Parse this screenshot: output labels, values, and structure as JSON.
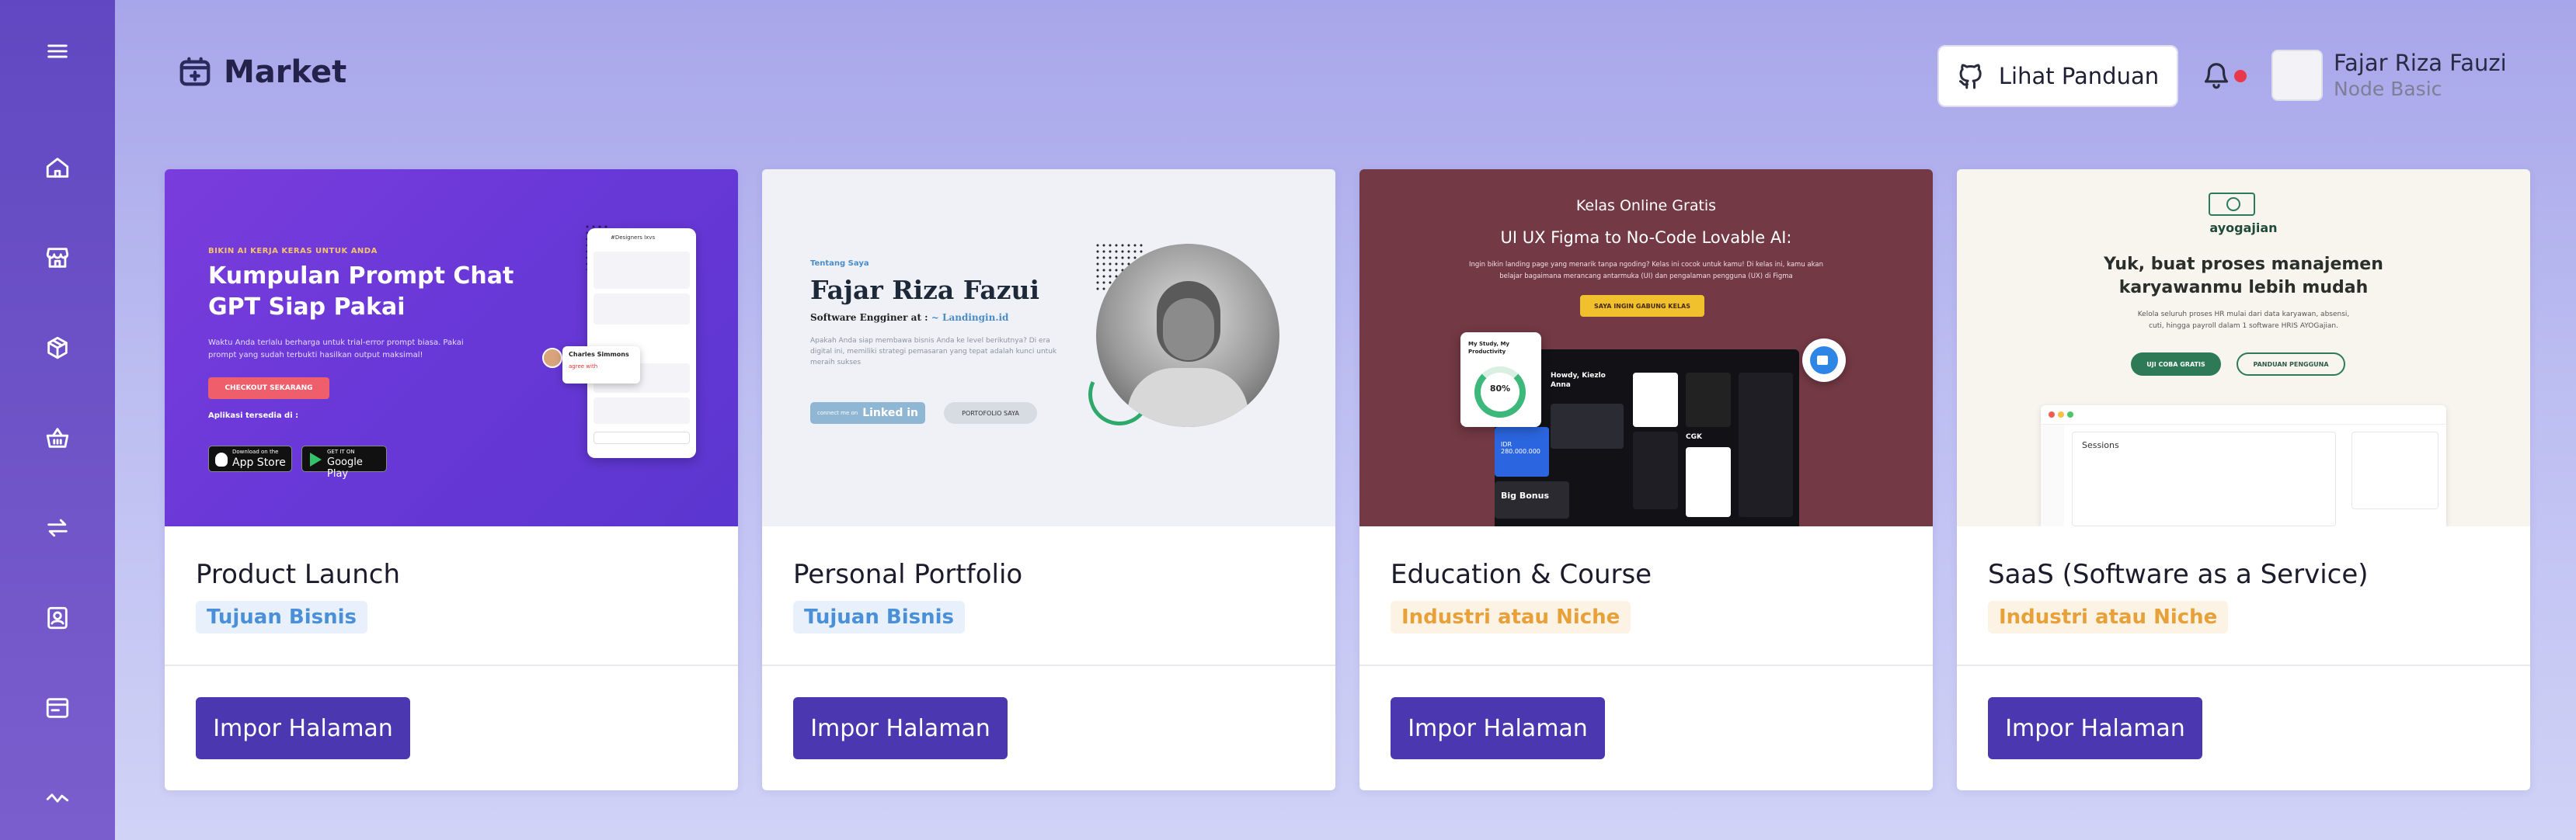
{
  "header": {
    "title": "Market",
    "guide_label": "Lihat Panduan",
    "user_name": "Fajar Riza Fauzi",
    "user_plan": "Node Basic"
  },
  "sidebar": {
    "items": [
      "menu-icon",
      "home-icon",
      "store-icon",
      "box-icon",
      "basket-icon",
      "transfer-icon",
      "contact-icon",
      "browser-icon",
      "activity-icon"
    ]
  },
  "colors": {
    "sidebar": "#6148c2",
    "primary_button": "#4b38b0",
    "tag_blue": "#4a90d9",
    "tag_orange": "#e8a038",
    "notification": "#e8384c"
  },
  "cards": [
    {
      "title": "Product Launch",
      "tag": "Tujuan Bisnis",
      "tag_style": "blue",
      "button": "Impor Halaman",
      "thumb": {
        "eyebrow": "BIKIN AI KERJA KERAS UNTUK ANDA",
        "headline_1": "Kumpulan Prompt Chat",
        "headline_2": "GPT Siap Pakai",
        "body_1": "Waktu Anda terlalu berharga untuk trial-error prompt biasa. Pakai",
        "body_2": "prompt yang sudah terbukti hasilkan output maksimal!",
        "cta": "CHECKOUT SEKARANG",
        "available": "Aplikasi tersedia di :",
        "appstore_small": "Download on the",
        "appstore": "App Store",
        "gplay_small": "GET IT ON",
        "gplay": "Google Play",
        "chat_header": "#Designers Ixvs",
        "chat_popup_name": "Charles Simmons",
        "chat_popup_text": "agree with"
      }
    },
    {
      "title": "Personal Portfolio",
      "tag": "Tujuan Bisnis",
      "tag_style": "blue",
      "button": "Impor Halaman",
      "thumb": {
        "eyebrow": "Tentang Saya",
        "name": "Fajar Riza Fazui",
        "role_prefix": "Software Engginer at : ",
        "role_link": "~ Landingin.id",
        "body_1": "Apakah Anda siap membawa bisnis Anda ke level berikutnya? Di era",
        "body_2": "digital ini, memiliki strategi pemasaran yang tepat adalah kunci untuk",
        "body_3": "meraih sukses",
        "linkedin_prefix": "connect me on",
        "linkedin": "Linked in",
        "portfolio_btn": "PORTOFOLIO SAYA"
      }
    },
    {
      "title": "Education & Course",
      "tag": "Industri atau Niche",
      "tag_style": "orange",
      "button": "Impor Halaman",
      "thumb": {
        "eyebrow": "Kelas Online Gratis",
        "headline": "UI UX Figma to No-Code Lovable AI:",
        "body_1": "Ingin bikin landing page yang menarik tanpa ngoding? Kelas ini cocok untuk kamu! Di kelas ini, kamu akan",
        "body_2": "belajar bagaimana merancang antarmuka (UI) dan pengalaman pengguna (UX) di Figma",
        "cta": "SAYA INGIN GABUNG KELAS",
        "widget_title": "My Study, My Productivity",
        "widget_pct": "80%",
        "mock_greeting": "Howdy, Kiezlo Anna",
        "mock_big": "Big Bonus",
        "mock_amount": "IDR 280.000.000",
        "mock_cgk": "CGK"
      }
    },
    {
      "title": "SaaS (Software as a Service)",
      "tag": "Industri atau Niche",
      "tag_style": "orange",
      "button": "Impor Halaman",
      "thumb": {
        "brand": "ayogajian",
        "headline_1": "Yuk, buat proses manajemen",
        "headline_2": "karyawanmu lebih mudah",
        "body_1": "Kelola seluruh proses HR mulai dari data karyawan, absensi,",
        "body_2": "cuti, hingga payroll dalam 1 software HRIS AYOGajian.",
        "cta_primary": "UJI COBA GRATIS",
        "cta_secondary": "PANDUAN PENGGUNA",
        "mock_sessions": "Sessions"
      }
    }
  ]
}
